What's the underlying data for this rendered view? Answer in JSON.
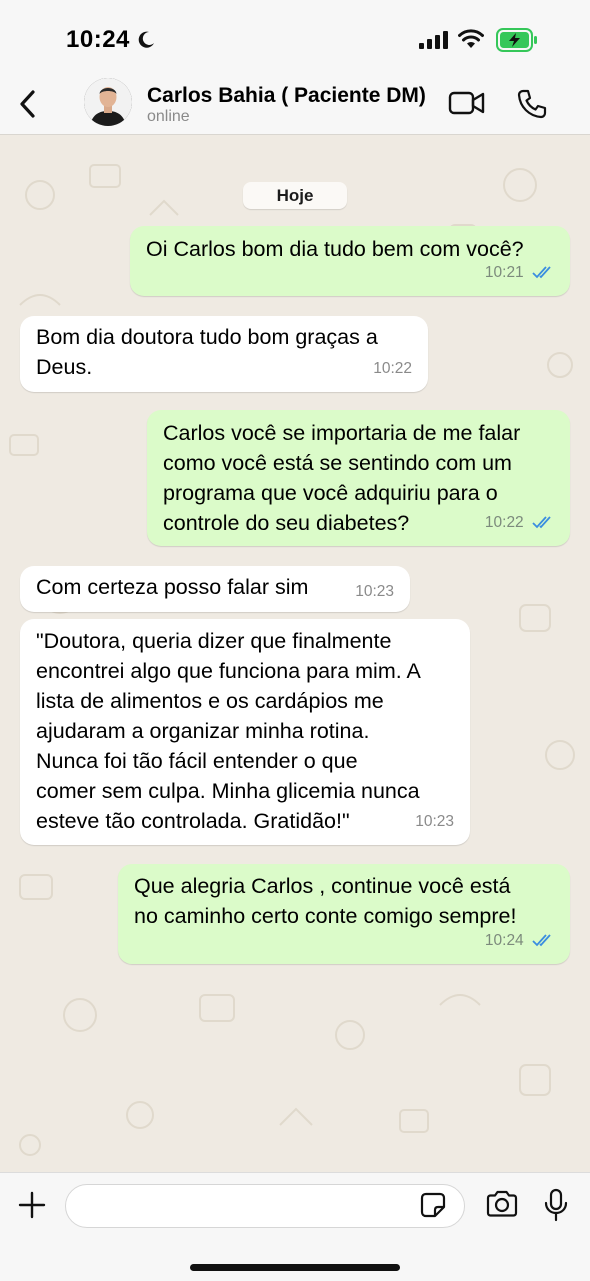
{
  "status_bar": {
    "time": "10:24"
  },
  "header": {
    "contact_name": "Carlos Bahia ( Paciente DM)",
    "contact_status": "online"
  },
  "chat": {
    "date_label": "Hoje",
    "messages": [
      {
        "direction": "outgoing",
        "text": "Oi Carlos bom dia tudo bem com você?",
        "time": "10:21",
        "read": true
      },
      {
        "direction": "incoming",
        "text": "Bom dia doutora tudo bom graças a\nDeus.",
        "time": "10:22"
      },
      {
        "direction": "outgoing",
        "text": "Carlos você se importaria de me falar\ncomo você está se sentindo com um\nprograma que você adquiriu para o\ncontrole do seu diabetes?",
        "time": "10:22",
        "read": true
      },
      {
        "direction": "incoming",
        "text": "Com certeza posso falar sim",
        "time": "10:23"
      },
      {
        "direction": "incoming",
        "text": "\"Doutora, queria dizer que finalmente\nencontrei algo que funciona para mim. A\nlista de alimentos e os cardápios me\najudaram a organizar minha rotina.\nNunca foi tão fácil entender o que\ncomer sem culpa. Minha glicemia nunca\nesteve tão controlada. Gratidão!\"",
        "time": "10:23"
      },
      {
        "direction": "outgoing",
        "text": "Que alegria Carlos , continue você está\nno caminho certo conte comigo sempre!",
        "time": "10:24",
        "read": true
      }
    ]
  },
  "input": {
    "placeholder": ""
  },
  "colors": {
    "outgoing_bubble": "#dbfbc9",
    "incoming_bubble": "#ffffff",
    "chat_background": "#efeae2",
    "read_ticks": "#3a8de0",
    "battery_charging": "#35c759"
  },
  "icons": {
    "back": "chevron-left-icon",
    "video": "video-camera-icon",
    "call": "phone-icon",
    "plus": "plus-icon",
    "sticker": "sticker-icon",
    "camera": "camera-icon",
    "mic": "microphone-icon"
  }
}
